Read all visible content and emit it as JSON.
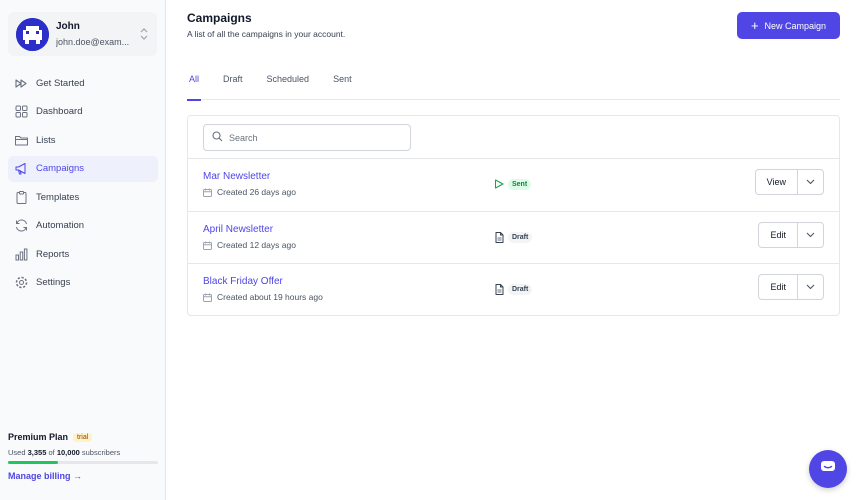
{
  "user": {
    "name": "John",
    "email": "john.doe@exam..."
  },
  "nav": {
    "items": [
      {
        "label": "Get Started",
        "icon": "play-forward-icon",
        "active": false
      },
      {
        "label": "Dashboard",
        "icon": "grid-icon",
        "active": false
      },
      {
        "label": "Lists",
        "icon": "folder-icon",
        "active": false
      },
      {
        "label": "Campaigns",
        "icon": "megaphone-icon",
        "active": true
      },
      {
        "label": "Templates",
        "icon": "clipboard-icon",
        "active": false
      },
      {
        "label": "Automation",
        "icon": "refresh-icon",
        "active": false
      },
      {
        "label": "Reports",
        "icon": "bar-chart-icon",
        "active": false
      },
      {
        "label": "Settings",
        "icon": "gear-icon",
        "active": false
      }
    ]
  },
  "plan": {
    "name": "Premium Plan",
    "badge": "trial",
    "used_prefix": "Used",
    "used": "3,355",
    "of_word": "of",
    "total": "10,000",
    "unit": "subscribers",
    "usage_fraction": 0.3355,
    "billing_link": "Manage billing →"
  },
  "header": {
    "title": "Campaigns",
    "subtitle": "A list of all the campaigns in your account.",
    "new_button": "New Campaign"
  },
  "tabs": [
    {
      "label": "All",
      "active": true
    },
    {
      "label": "Draft",
      "active": false
    },
    {
      "label": "Scheduled",
      "active": false
    },
    {
      "label": "Sent",
      "active": false
    }
  ],
  "search": {
    "placeholder": "Search"
  },
  "campaigns": [
    {
      "name": "Mar Newsletter",
      "created": "Created 26 days ago",
      "status": "Sent",
      "action": "View"
    },
    {
      "name": "April Newsletter",
      "created": "Created 12 days ago",
      "status": "Draft",
      "action": "Edit"
    },
    {
      "name": "Black Friday Offer",
      "created": "Created about 19 hours ago",
      "status": "Draft",
      "action": "Edit"
    }
  ],
  "colors": {
    "accent": "#4f46e5",
    "sent": "#15803d",
    "progress": "#22c55e",
    "avatar": "#2b2ec8"
  }
}
